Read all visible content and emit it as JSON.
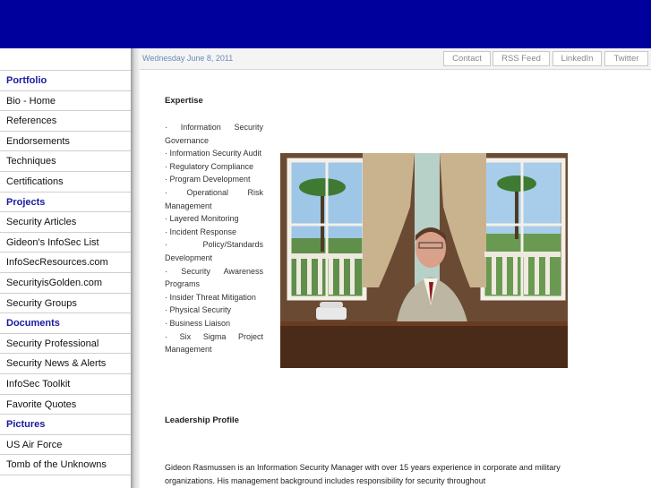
{
  "topbar": {
    "date": "Wednesday June 8, 2011",
    "links": [
      "Contact",
      "RSS Feed",
      "LinkedIn",
      "Twitter"
    ]
  },
  "sidebar": {
    "items": [
      {
        "label": "Portfolio",
        "section": true
      },
      {
        "label": "Bio - Home",
        "section": false
      },
      {
        "label": "References",
        "section": false
      },
      {
        "label": "Endorsements",
        "section": false
      },
      {
        "label": "Techniques",
        "section": false
      },
      {
        "label": "Certifications",
        "section": false
      },
      {
        "label": "Projects",
        "section": true
      },
      {
        "label": "Security Articles",
        "section": false
      },
      {
        "label": "Gideon's InfoSec List",
        "section": false
      },
      {
        "label": "InfoSecResources.com",
        "section": false
      },
      {
        "label": "SecurityisGolden.com",
        "section": false
      },
      {
        "label": "Security Groups",
        "section": false
      },
      {
        "label": "Documents",
        "section": true
      },
      {
        "label": "Security Professional",
        "section": false
      },
      {
        "label": "Security News & Alerts",
        "section": false
      },
      {
        "label": "InfoSec Toolkit",
        "section": false
      },
      {
        "label": "Favorite Quotes",
        "section": false
      },
      {
        "label": "Pictures",
        "section": true
      },
      {
        "label": "US Air Force",
        "section": false
      },
      {
        "label": "Tomb of the Unknowns",
        "section": false
      }
    ]
  },
  "main": {
    "expertise_heading": "Expertise",
    "expertise_items": [
      "· Information Security Governance",
      "· Information Security Audit",
      "· Regulatory Compliance",
      "· Program Development",
      "· Operational Risk Management",
      "· Layered Monitoring",
      "· Incident Response",
      "· Policy/Standards Development",
      "· Security Awareness Programs",
      "· Insider Threat Mitigation",
      "· Physical Security",
      "· Business Liaison",
      "· Six Sigma Project Management"
    ],
    "leadership_heading": "Leadership Profile",
    "bio_text": "Gideon Rasmussen is an Information Security Manager with over 15 years experience in corporate and military organizations. His management background includes responsibility for security throughout"
  }
}
